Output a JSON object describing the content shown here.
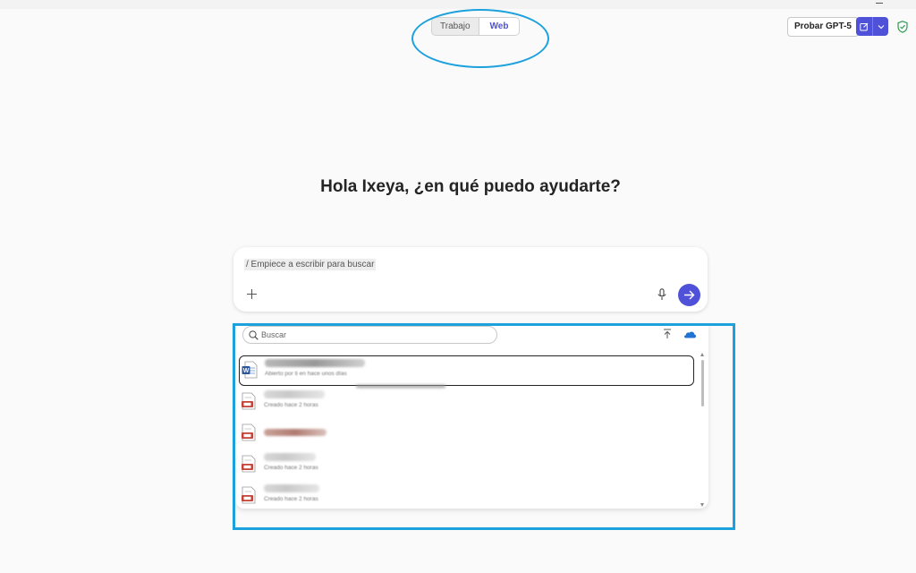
{
  "mode_toggle": {
    "options": [
      "Trabajo",
      "Web"
    ],
    "selected": "Web"
  },
  "header": {
    "try_button": "Probar GPT-5"
  },
  "greeting": "Hola Ixeya, ¿en qué puedo ayudarte?",
  "composer": {
    "text": "/ Empiece a escribir para buscar"
  },
  "picker": {
    "search_placeholder": "Buscar",
    "files": [
      {
        "type": "word",
        "name": "████████████",
        "meta": "Abierto por ti en hace unos días"
      },
      {
        "type": "pdf",
        "name": "████████",
        "meta": "Creado hace 2 horas"
      },
      {
        "type": "pdf",
        "name": "████████████",
        "meta": ""
      },
      {
        "type": "pdf",
        "name": "████████",
        "meta": "Creado hace 2 horas"
      },
      {
        "type": "pdf",
        "name": "████████",
        "meta": "Creado hace 2 horas"
      }
    ]
  },
  "colors": {
    "accent": "#4f52d8",
    "annotation": "#1ca1dd",
    "shield": "#2e9e55",
    "pdf": "#c4443a",
    "word": "#2b579a"
  }
}
